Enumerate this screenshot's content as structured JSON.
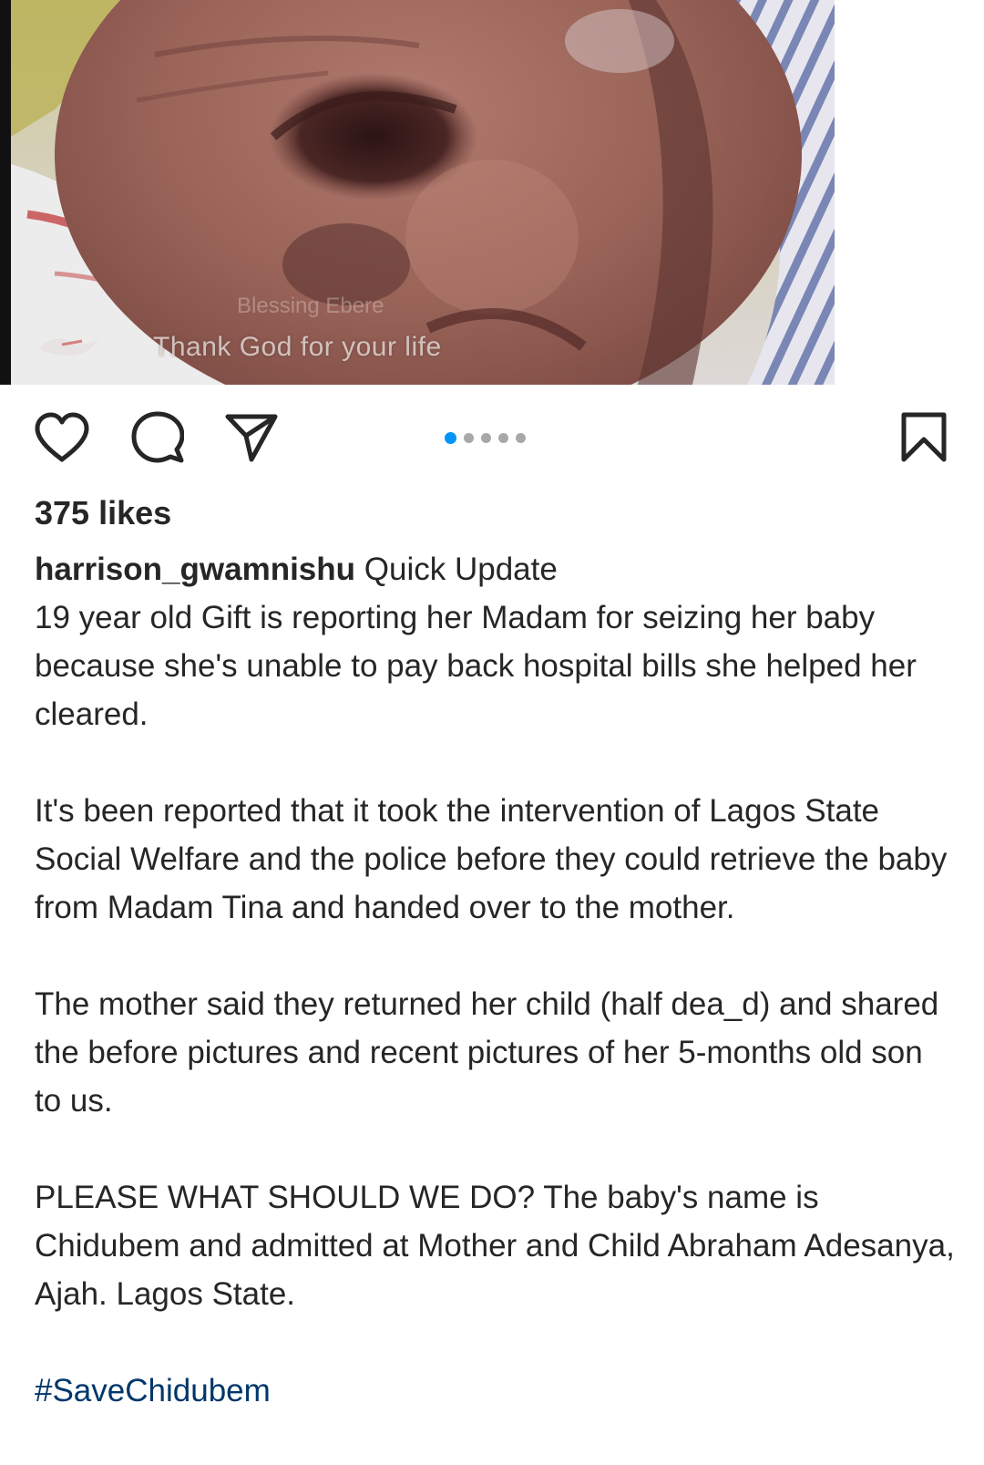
{
  "post": {
    "image_overlay": {
      "caption": "Thank God for your life",
      "faint_text": "Blessing Ebere"
    },
    "actions": {
      "like_icon": "heart-icon",
      "comment_icon": "comment-bubble-icon",
      "share_icon": "paper-plane-icon",
      "save_icon": "bookmark-icon"
    },
    "carousel": {
      "total": 5,
      "active_index": 0,
      "active_color": "#0095f6",
      "inactive_color": "#a8a8a8"
    },
    "likes_text": "375 likes",
    "author": "harrison_gwamnishu",
    "caption_lead": "Quick Update",
    "caption_paragraphs": [
      "19 year old Gift is reporting her Madam for seizing her baby because she's unable to pay back hospital bills she helped her cleared.",
      "It's been reported that it took the intervention of Lagos State Social Welfare and the police before they could retrieve the baby from Madam Tina and handed over to the mother.",
      "The mother said they returned her child (half dea_d) and shared the before pictures and recent pictures of her 5-months old son to us.",
      "PLEASE WHAT SHOULD WE DO? The baby's name is Chidubem and admitted at Mother and Child Abraham Adesanya, Ajah. Lagos State."
    ],
    "hashtag": "#SaveChidubem",
    "hashtag_color": "#00376b"
  }
}
